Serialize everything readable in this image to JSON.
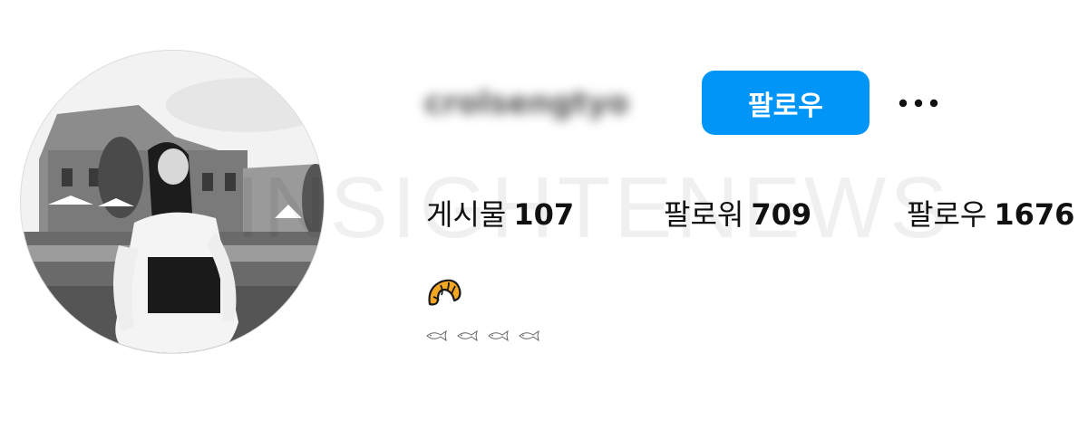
{
  "profile": {
    "username": "crolsengtyo",
    "watermark": "INSIGHTENEWS",
    "follow_label": "팔로우",
    "more_icon": "more-horizontal-icon",
    "bio_emoji": "croissant-icon",
    "bio_fish_icon": "fish-icon",
    "bio_fish_count": 4,
    "accent_color": "#0095f6"
  },
  "stats": {
    "posts_label": "게시물",
    "posts_value": "107",
    "followers_label": "팔로워",
    "followers_value": "709",
    "following_label": "팔로우",
    "following_value": "1676"
  }
}
